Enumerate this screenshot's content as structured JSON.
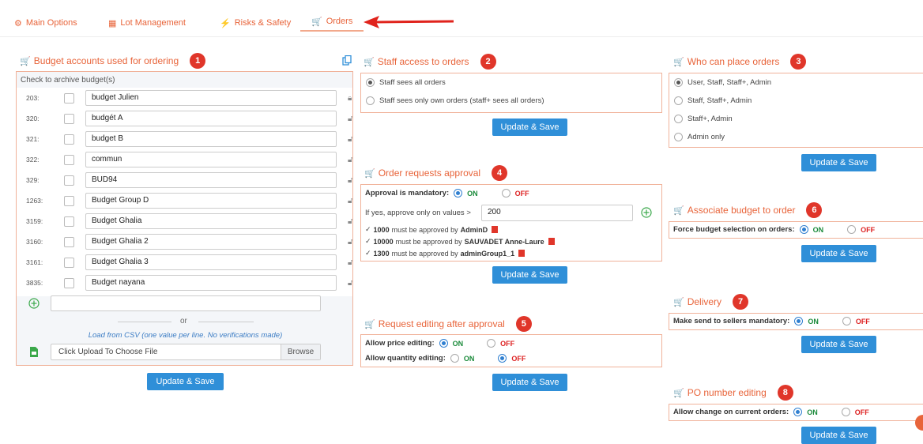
{
  "tabs": [
    {
      "label": "Main Options",
      "icon": "gears-icon"
    },
    {
      "label": "Lot Management",
      "icon": "warehouse-icon"
    },
    {
      "label": "Risks & Safety",
      "icon": "warning-icon"
    },
    {
      "label": "Orders",
      "icon": "cart-icon"
    }
  ],
  "budget": {
    "title": "Budget accounts used for ordering",
    "badge": "1",
    "archive_label": "Check to archive budget(s)",
    "rows": [
      {
        "num": "203:",
        "name": "budget Julien"
      },
      {
        "num": "320:",
        "name": "budgét A"
      },
      {
        "num": "321:",
        "name": "budget B"
      },
      {
        "num": "322:",
        "name": "commun"
      },
      {
        "num": "329:",
        "name": "BUD94"
      },
      {
        "num": "1263:",
        "name": "Budget Group D"
      },
      {
        "num": "3159:",
        "name": "Budget Ghalia"
      },
      {
        "num": "3160:",
        "name": "Budget Ghalia 2"
      },
      {
        "num": "3161:",
        "name": "Budget Ghalia 3"
      },
      {
        "num": "3835:",
        "name": "Budget nayana"
      }
    ],
    "new_value": "",
    "or_label": "or",
    "csv_note": "Load from CSV (one value per line. No verifications made)",
    "file_placeholder": "Click Upload To Choose File",
    "browse_label": "Browse",
    "save_label": "Update & Save"
  },
  "staff_access": {
    "title": "Staff access to orders",
    "badge": "2",
    "options": [
      "Staff sees all orders",
      "Staff sees only own orders (staff+ sees all orders)"
    ],
    "save_label": "Update & Save"
  },
  "who_can_order": {
    "title": "Who can place orders",
    "badge": "3",
    "options": [
      "User, Staff, Staff+, Admin",
      "Staff, Staff+, Admin",
      "Staff+, Admin",
      "Admin only"
    ],
    "save_label": "Update & Save"
  },
  "approval": {
    "title": "Order requests approval",
    "badge": "4",
    "mandatory_label": "Approval is mandatory:",
    "on": "ON",
    "off": "OFF",
    "threshold_label": "If yes, approve only on values >",
    "threshold_value": "200",
    "rules": [
      {
        "amount": "1000",
        "text": "must be approved by",
        "who": "AdminD"
      },
      {
        "amount": "10000",
        "text": "must be approved by",
        "who": "SAUVADET Anne-Laure"
      },
      {
        "amount": "1300",
        "text": "must be approved by",
        "who": "adminGroup1_1"
      }
    ],
    "save_label": "Update & Save"
  },
  "editing": {
    "title": "Request editing after approval",
    "badge": "5",
    "price_label": "Allow price editing:",
    "quantity_label": "Allow quantity editing:",
    "on": "ON",
    "off": "OFF",
    "save_label": "Update & Save"
  },
  "associate": {
    "title": "Associate budget to order",
    "badge": "6",
    "label": "Force budget selection on orders:",
    "on": "ON",
    "off": "OFF",
    "save_label": "Update & Save"
  },
  "delivery": {
    "title": "Delivery",
    "badge": "7",
    "label": "Make send to sellers mandatory:",
    "on": "ON",
    "off": "OFF",
    "save_label": "Update & Save"
  },
  "po": {
    "title": "PO number editing",
    "badge": "8",
    "label": "Allow change on current orders:",
    "on": "ON",
    "off": "OFF",
    "save_label": "Update & Save"
  },
  "colors": {
    "accent": "#e8643a",
    "button": "#2f8fd8",
    "badge": "#e0362a",
    "on": "#1a8a3a",
    "off": "#dd2222"
  }
}
